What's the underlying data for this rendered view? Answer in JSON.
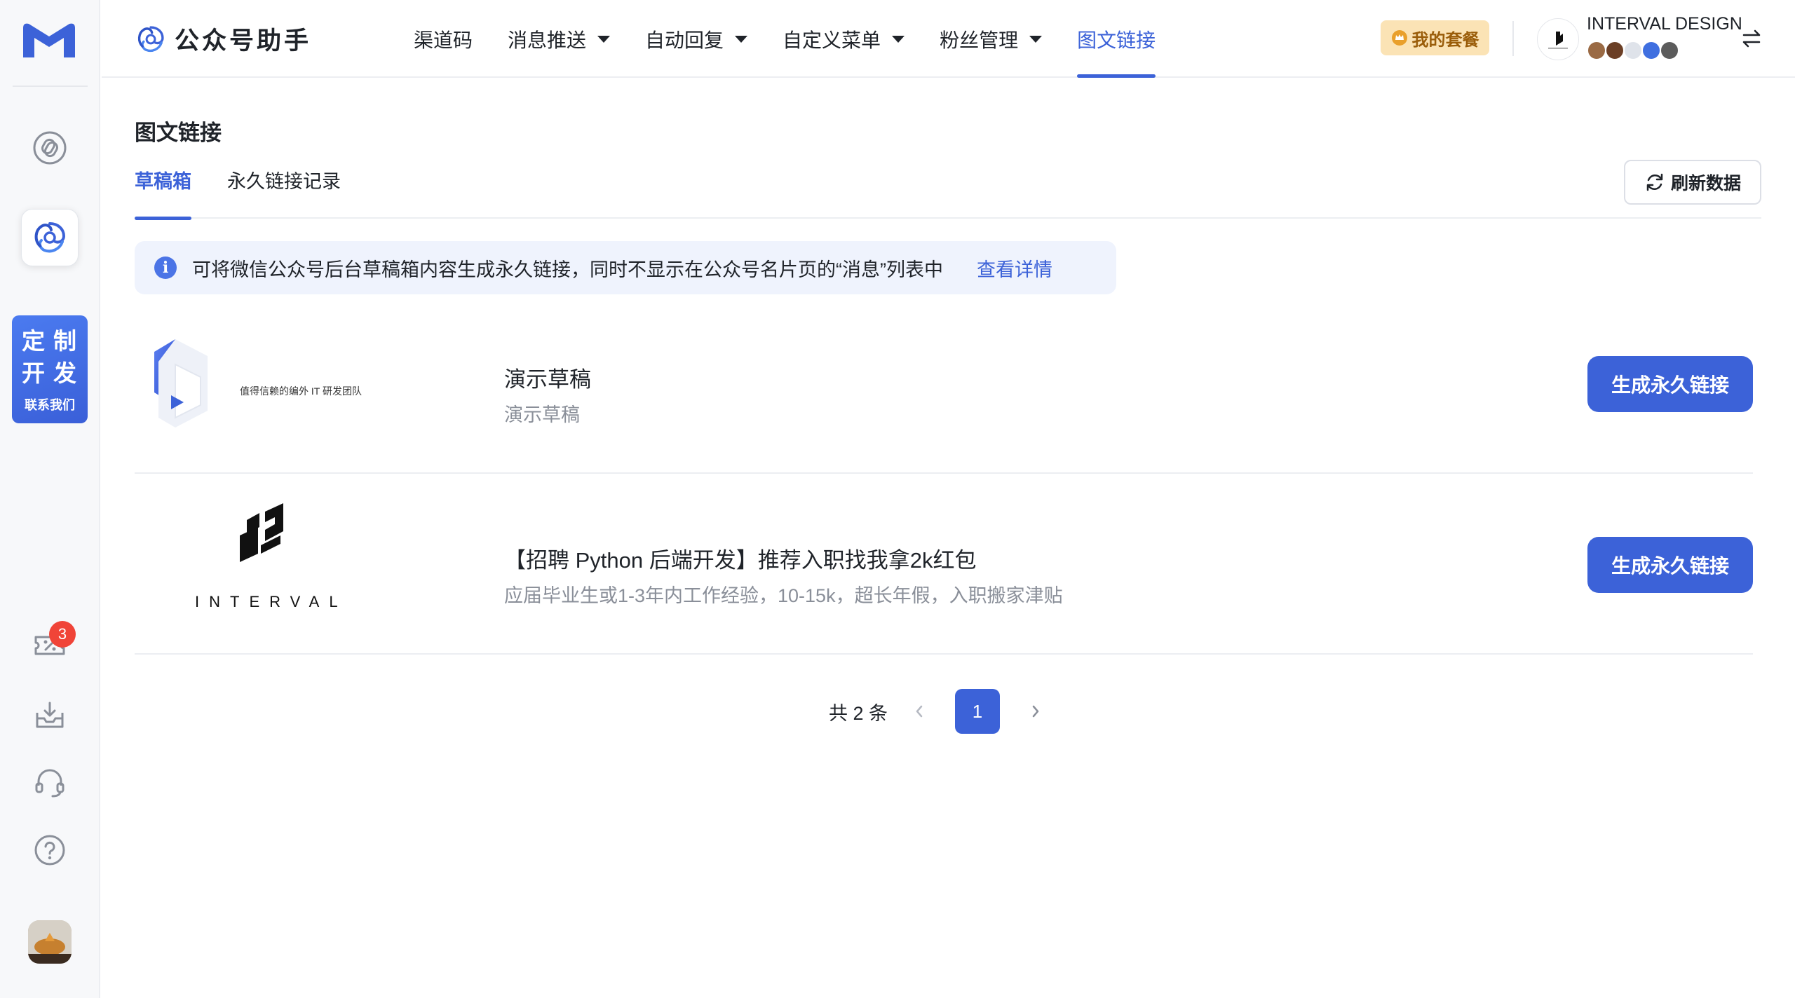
{
  "brand": {
    "name": "公众号助手"
  },
  "nav": [
    {
      "label": "渠道码",
      "dropdown": false,
      "active": false
    },
    {
      "label": "消息推送",
      "dropdown": true,
      "active": false
    },
    {
      "label": "自动回复",
      "dropdown": true,
      "active": false
    },
    {
      "label": "自定义菜单",
      "dropdown": true,
      "active": false
    },
    {
      "label": "粉丝管理",
      "dropdown": true,
      "active": false
    },
    {
      "label": "图文链接",
      "dropdown": false,
      "active": true
    }
  ],
  "plan_button": "我的套餐",
  "account": {
    "name": "INTERVAL DESIGN"
  },
  "sidebar": {
    "promo": {
      "line1": "定制",
      "line2": "开发",
      "line3": "联系我们"
    },
    "notification_count": "3"
  },
  "page": {
    "title": "图文链接",
    "tabs": [
      {
        "label": "草稿箱",
        "active": true
      },
      {
        "label": "永久链接记录",
        "active": false
      }
    ],
    "refresh_label": "刷新数据",
    "notice": {
      "text": "可将微信公众号后台草稿箱内容生成永久链接，同时不显示在公众号名片页的“消息”列表中",
      "link": "查看详情"
    },
    "items": [
      {
        "title": "演示草稿",
        "desc": "演示草稿",
        "thumb_caption": "值得信赖的编外 IT 研发团队",
        "button": "生成永久链接"
      },
      {
        "title": "【招聘 Python 后端开发】推荐入职找我拿2k红包",
        "desc": "应届毕业生或1-3年内工作经验，10-15k，超长年假，入职搬家津贴",
        "thumb_caption": "INTERVAL",
        "button": "生成永久链接"
      }
    ],
    "pagination": {
      "total": "共 2 条",
      "current": "1"
    }
  },
  "colors": {
    "accent": "#3c62d8",
    "plan_bg": "#fbe3b5",
    "badge": "#f04438"
  }
}
